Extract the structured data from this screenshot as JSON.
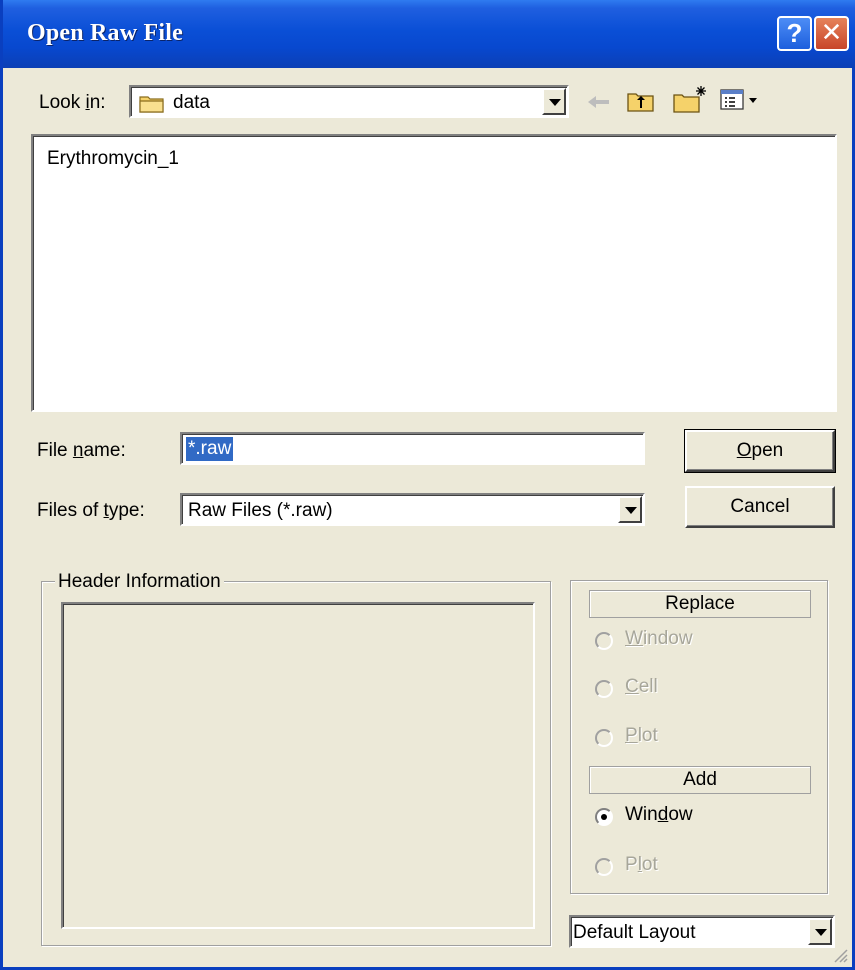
{
  "dialog": {
    "title": "Open Raw File"
  },
  "titlebar_buttons": {
    "help_label": "?",
    "close_label": "✕"
  },
  "look_in": {
    "label_prefix": "Look ",
    "label_mnemonic": "i",
    "label_suffix": "n:",
    "value": "data",
    "icon": "folder-icon"
  },
  "toolbar": {
    "icons": [
      "back-arrow-icon",
      "up-folder-icon",
      "new-folder-icon",
      "view-menu-icon"
    ]
  },
  "file_list": {
    "items": [
      "Erythromycin_1"
    ]
  },
  "file_name": {
    "label_prefix": "File ",
    "label_mnemonic": "n",
    "label_suffix": "ame:",
    "value": "*.raw"
  },
  "file_type": {
    "label_prefix": "Files of ",
    "label_mnemonic": "t",
    "label_suffix": "ype:",
    "value": "Raw Files (*.raw)"
  },
  "buttons": {
    "open_mnemonic": "O",
    "open_rest": "pen",
    "cancel": "Cancel"
  },
  "header_information": {
    "title": "Header Information"
  },
  "replace": {
    "header": "Replace",
    "options": [
      {
        "mnemonic": "W",
        "rest": "indow",
        "enabled": false,
        "selected": false
      },
      {
        "mnemonic": "C",
        "rest": "ell",
        "enabled": false,
        "selected": false
      },
      {
        "mnemonic": "P",
        "rest": "lot",
        "enabled": false,
        "selected": false
      }
    ]
  },
  "add": {
    "header": "Add",
    "options": [
      {
        "pre": "Win",
        "mnemonic": "d",
        "rest": "ow",
        "enabled": true,
        "selected": true
      },
      {
        "pre": "P",
        "mnemonic": "l",
        "rest": "ot",
        "enabled": false,
        "selected": false
      }
    ]
  },
  "layout_select": {
    "value": "Default Layout"
  }
}
